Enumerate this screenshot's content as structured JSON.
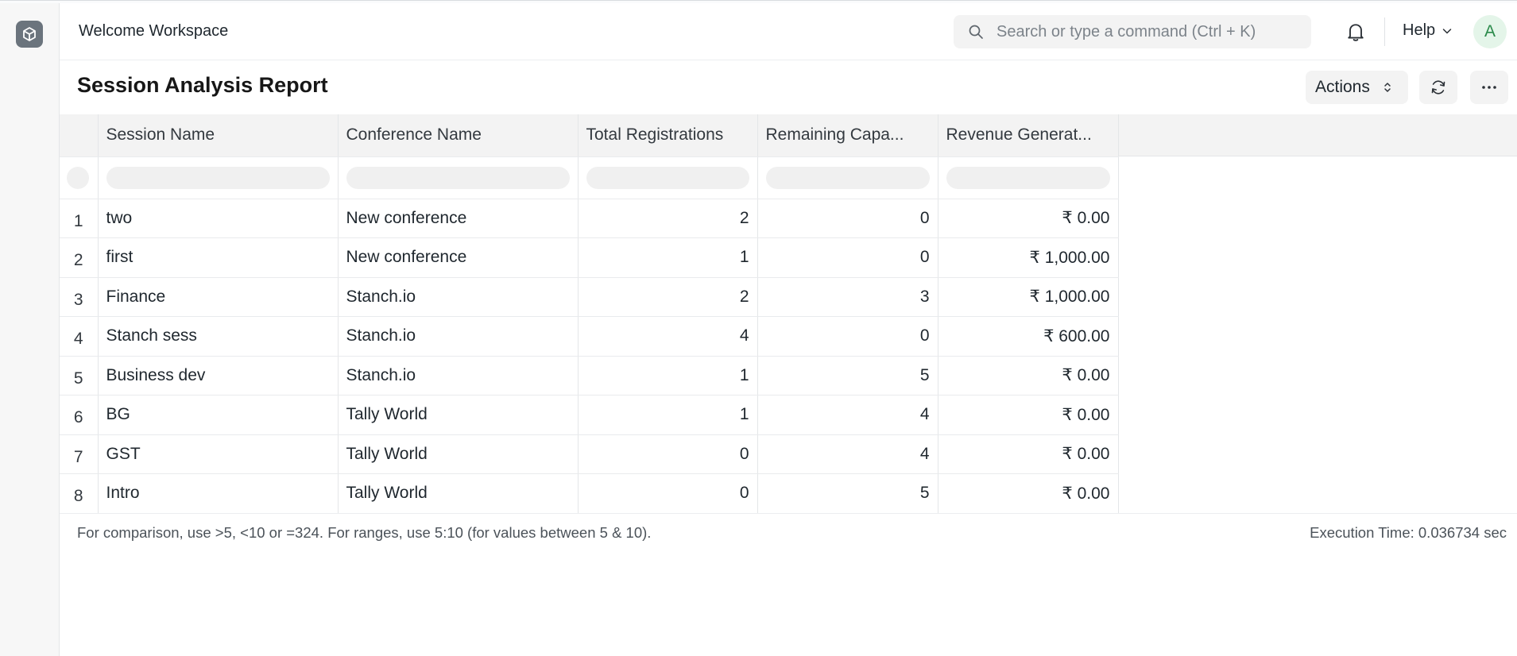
{
  "navbar": {
    "workspace_title": "Welcome Workspace",
    "search_placeholder": "Search or type a command (Ctrl + K)",
    "help_label": "Help",
    "avatar_initial": "A"
  },
  "page": {
    "title": "Session Analysis Report",
    "actions_label": "Actions"
  },
  "report": {
    "columns": [
      "Session Name",
      "Conference Name",
      "Total Registrations",
      "Remaining Capa...",
      "Revenue Generat..."
    ],
    "rows": [
      {
        "no": "1",
        "session": "two",
        "conference": "New conference",
        "registrations": "2",
        "remaining": "0",
        "revenue": "₹ 0.00"
      },
      {
        "no": "2",
        "session": "first",
        "conference": "New conference",
        "registrations": "1",
        "remaining": "0",
        "revenue": "₹ 1,000.00"
      },
      {
        "no": "3",
        "session": "Finance",
        "conference": "Stanch.io",
        "registrations": "2",
        "remaining": "3",
        "revenue": "₹ 1,000.00"
      },
      {
        "no": "4",
        "session": "Stanch sess",
        "conference": "Stanch.io",
        "registrations": "4",
        "remaining": "0",
        "revenue": "₹ 600.00"
      },
      {
        "no": "5",
        "session": "Business dev",
        "conference": "Stanch.io",
        "registrations": "1",
        "remaining": "5",
        "revenue": "₹ 0.00"
      },
      {
        "no": "6",
        "session": "BG",
        "conference": "Tally World",
        "registrations": "1",
        "remaining": "4",
        "revenue": "₹ 0.00"
      },
      {
        "no": "7",
        "session": "GST",
        "conference": "Tally World",
        "registrations": "0",
        "remaining": "4",
        "revenue": "₹ 0.00"
      },
      {
        "no": "8",
        "session": "Intro",
        "conference": "Tally World",
        "registrations": "0",
        "remaining": "5",
        "revenue": "₹ 0.00"
      }
    ]
  },
  "footer": {
    "filter_help": "For comparison, use >5, <10 or =324. For ranges, use 5:10 (for values between 5 & 10).",
    "execution_time": "Execution Time: 0.036734 sec"
  },
  "icons": {
    "app_logo": "cube-icon",
    "search": "search-icon",
    "notifications": "bell-icon",
    "help_dropdown": "chevron-down-icon",
    "actions_sort": "up-down-chevron-icon",
    "refresh": "refresh-icon",
    "more": "ellipsis-icon"
  },
  "colors": {
    "avatar_bg": "#e4f5e9",
    "avatar_text": "#2a8a4a",
    "logo_bg": "#6b747d",
    "header_bg": "#f3f3f3"
  }
}
